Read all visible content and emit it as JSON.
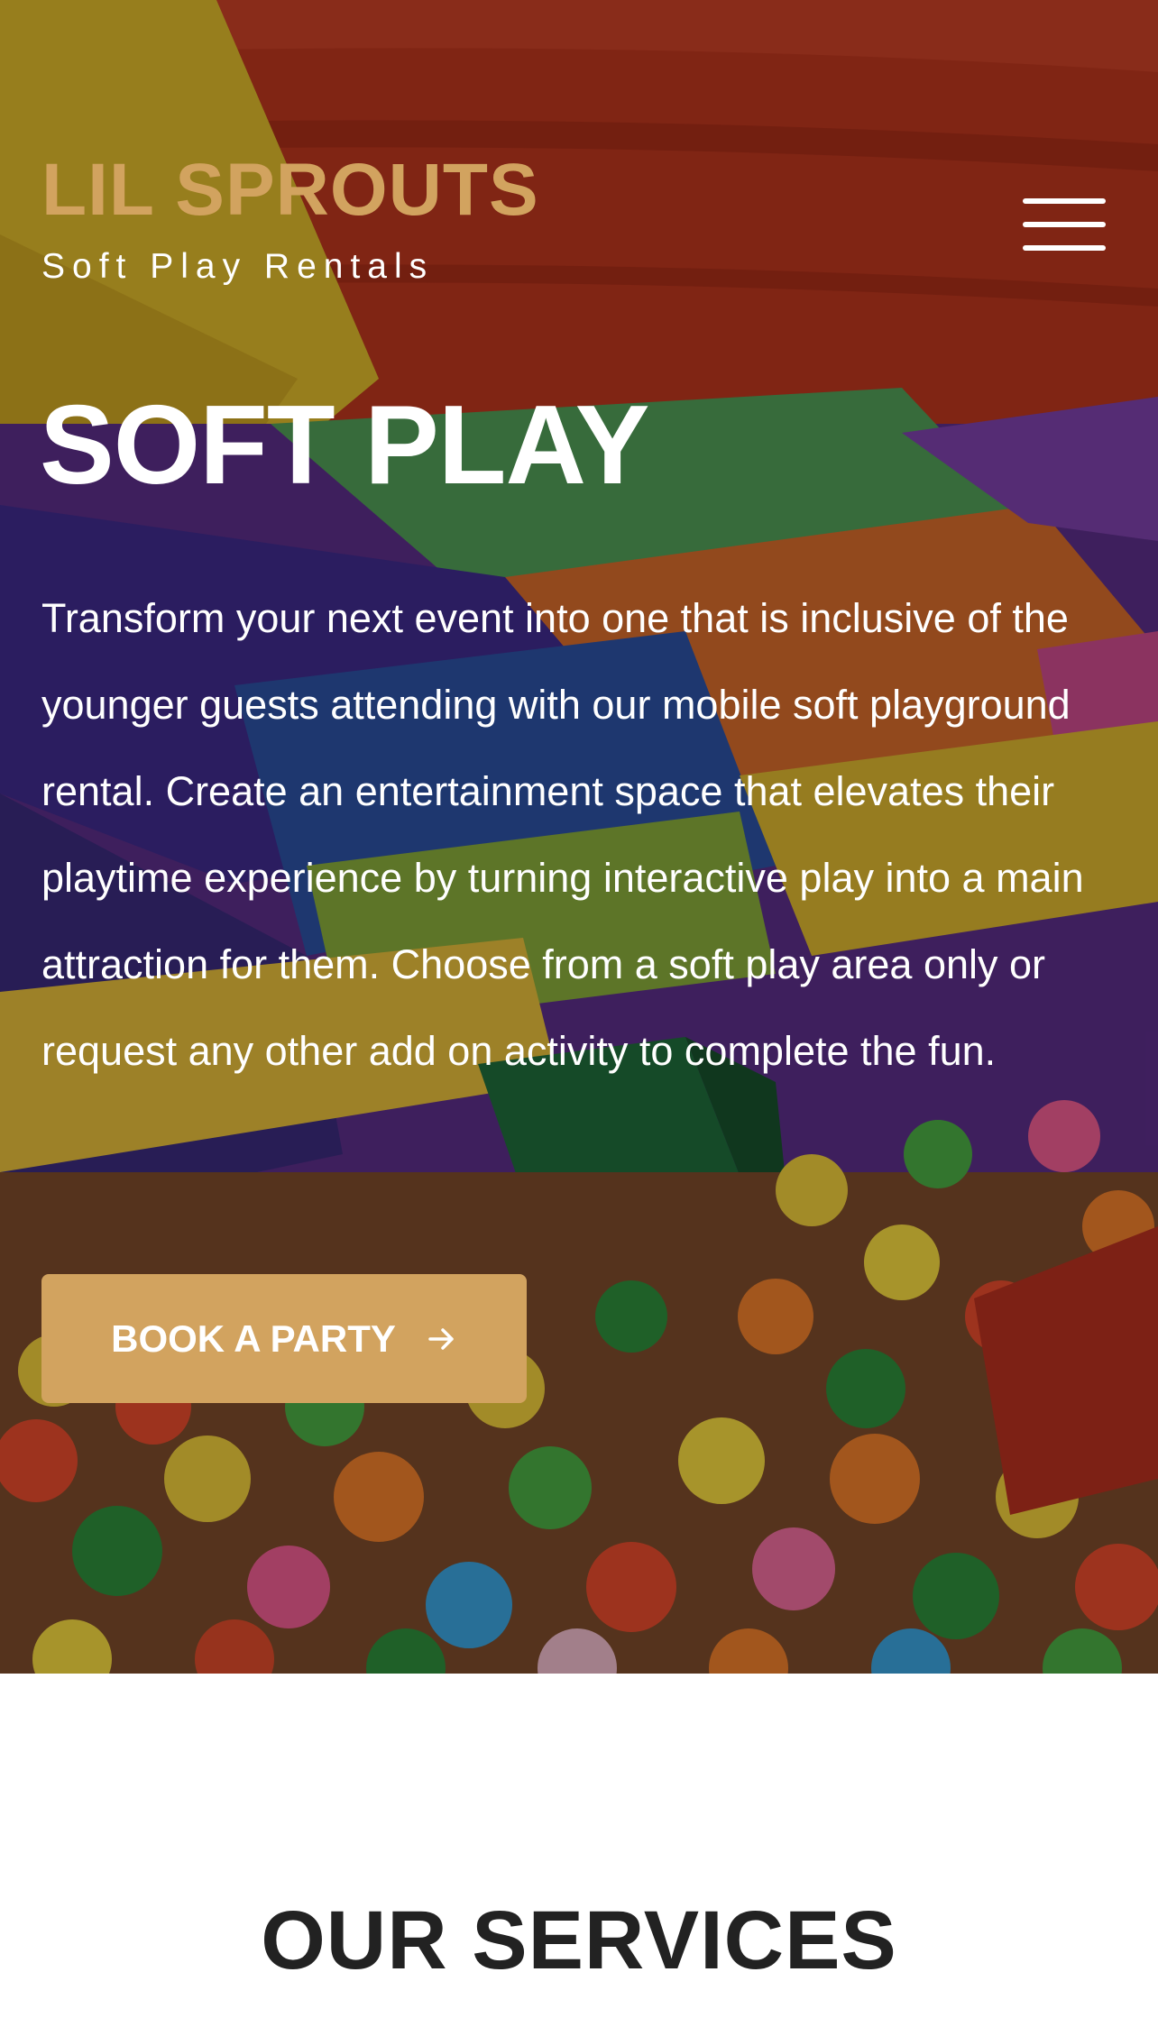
{
  "brand": {
    "name": "LIL SPROUTS",
    "tagline": "Soft Play Rentals"
  },
  "nav": {
    "menu_icon": "hamburger-menu-icon"
  },
  "hero": {
    "title": "SOFT PLAY",
    "description": "Transform your next event into one that is inclusive of the younger guests attending with our mobile soft playground rental. Create an entertainment space that elevates their playtime experience by turning interactive play into a main attraction for them. Choose from a soft play area only or request any other add on activity to complete the fun.",
    "cta_label": "BOOK A PARTY",
    "cta_icon": "arrow-right-icon",
    "background_image": "soft-play-ball-pit-photo"
  },
  "services": {
    "title": "OUR SERVICES"
  },
  "colors": {
    "accent": "#d2a35f",
    "hero_text": "#ffffff",
    "heading_dark": "#222222"
  }
}
